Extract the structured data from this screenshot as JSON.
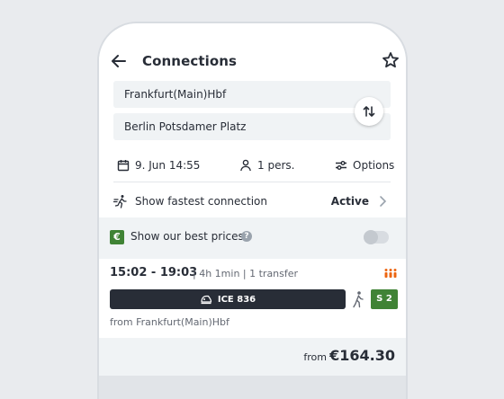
{
  "header": {
    "title": "Connections",
    "back_icon": "arrow-left-icon",
    "favorite_icon": "star-outline-icon"
  },
  "search": {
    "from": "Frankfurt(Main)Hbf",
    "to": "Berlin Potsdamer Platz",
    "swap_icon": "swap-vertical-icon"
  },
  "params": {
    "date": "9. Jun 14:55",
    "passengers": "1 pers.",
    "options": "Options"
  },
  "fastest": {
    "label": "Show fastest connection",
    "status": "Active"
  },
  "prices_banner": {
    "label": "Show our best prices",
    "badge": "€",
    "toggle_on": false
  },
  "connection": {
    "times": "15:02 - 19:03",
    "meta": "| 4h 1min | 1 transfer",
    "train": "ICE 836",
    "connector": "S 2",
    "from_station": "from Frankfurt(Main)Hbf",
    "price_prefix": "from",
    "price": "€164.30",
    "occupancy_color": "#ec6510"
  },
  "colors": {
    "accent_green": "#408335",
    "dark": "#282d37",
    "background": "#f0f3f5"
  }
}
